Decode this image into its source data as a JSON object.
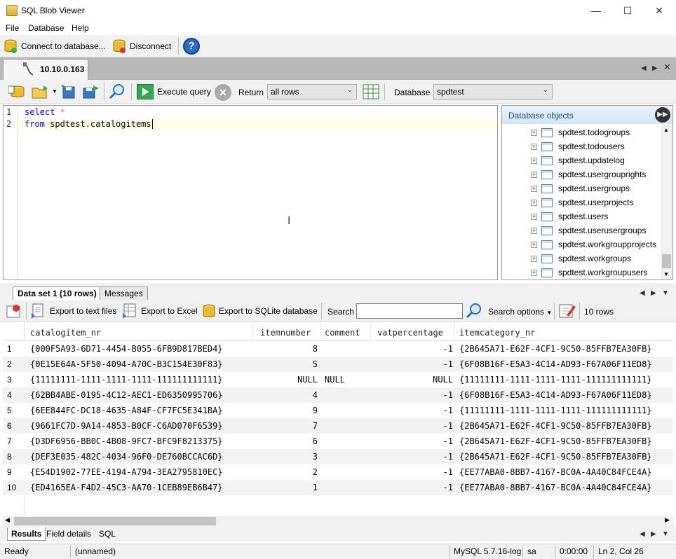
{
  "window": {
    "title": "SQL Blob Viewer",
    "minimize": "—",
    "maximize": "☐",
    "close": "✕"
  },
  "menu": [
    "File",
    "Database",
    "Help"
  ],
  "toolbar": {
    "connect_label": "Connect to database...",
    "disconnect_label": "Disconnect",
    "help_label": "?"
  },
  "doc_tab": {
    "label": "10.10.0.163"
  },
  "query_toolbar": {
    "execute_label": "Execute query",
    "return_label": "Return",
    "return_value": "all rows",
    "database_label": "Database",
    "database_value": "spdtest"
  },
  "editor": {
    "lines": [
      {
        "num": "1",
        "kw": "select",
        "rest": " *"
      },
      {
        "num": "2",
        "kw": "from",
        "rest": " spdtest.catalogitems"
      }
    ]
  },
  "objects": {
    "header": "Database objects",
    "items": [
      "spdtest.todogroups",
      "spdtest.todousers",
      "spdtest.updatelog",
      "spdtest.usergrouprights",
      "spdtest.usergroups",
      "spdtest.userprojects",
      "spdtest.users",
      "spdtest.userusergroups",
      "spdtest.workgroupprojects",
      "spdtest.workgroups",
      "spdtest.workgroupusers"
    ]
  },
  "result_tabs": [
    "Data set 1 (10 rows)",
    "Messages"
  ],
  "result_toolbar": {
    "export_text": "Export to text files",
    "export_excel": "Export to Excel",
    "export_sqlite": "Export to SQLite database",
    "search_label": "Search",
    "search_value": "",
    "search_options": "Search options",
    "row_count": "10 rows"
  },
  "grid": {
    "columns": [
      "catalogitem_nr",
      "itemnumber",
      "comment",
      "vatpercentage",
      "itemcategory_nr"
    ],
    "rows": [
      [
        "1",
        "{000F5A93-6D71-4454-B055-6FB9D817BED4}",
        "8",
        "",
        "-1",
        "{2B645A71-E62F-4CF1-9C50-85FFB7EA30FB}"
      ],
      [
        "2",
        "{0E15E64A-5F50-4094-A70C-B3C154E30F83}",
        "5",
        "",
        "-1",
        "{6F08B16F-E5A3-4C14-AD93-F67A06F11ED8}"
      ],
      [
        "3",
        "{11111111-1111-1111-1111-111111111111}",
        "NULL",
        "NULL",
        "NULL",
        "{11111111-1111-1111-1111-111111111111}"
      ],
      [
        "4",
        "{62BB4ABE-0195-4C12-AEC1-ED6350995706}",
        "4",
        "",
        "-1",
        "{6F08B16F-E5A3-4C14-AD93-F67A06F11ED8}"
      ],
      [
        "5",
        "{6EE844FC-DC18-4635-A84F-CF7FC5E341BA}",
        "9",
        "",
        "-1",
        "{11111111-1111-1111-1111-111111111111}"
      ],
      [
        "6",
        "{9661FC7D-9A14-4853-B0CF-C6AD070F6539}",
        "7",
        "",
        "-1",
        "{2B645A71-E62F-4CF1-9C50-85FFB7EA30FB}"
      ],
      [
        "7",
        "{D3DF6956-BB0C-4B08-9FC7-BFC9F8213375}",
        "6",
        "",
        "-1",
        "{2B645A71-E62F-4CF1-9C50-85FFB7EA30FB}"
      ],
      [
        "8",
        "{DEF3E035-482C-4034-96F0-DE760BCCAC6D}",
        "3",
        "",
        "-1",
        "{2B645A71-E62F-4CF1-9C50-85FFB7EA30FB}"
      ],
      [
        "9",
        "{E54D1902-77EE-4194-A794-3EA2795810EC}",
        "2",
        "",
        "-1",
        "{EE77ABA0-8BB7-4167-BC0A-4A40C84FCE4A}"
      ],
      [
        "10",
        "{ED4165EA-F4D2-45C3-AA70-1CEB89EB6B47}",
        "1",
        "",
        "-1",
        "{EE77ABA0-8BB7-4167-BC0A-4A40C84FCE4A}"
      ]
    ]
  },
  "bottom_tabs": [
    "Results",
    "Field details",
    "SQL"
  ],
  "status": {
    "state": "Ready",
    "file": "(unnamed)",
    "server": "MySQL 5.7.16-log",
    "user": "sa",
    "time": "0:00:00",
    "position": "Ln 2, Col 26"
  }
}
